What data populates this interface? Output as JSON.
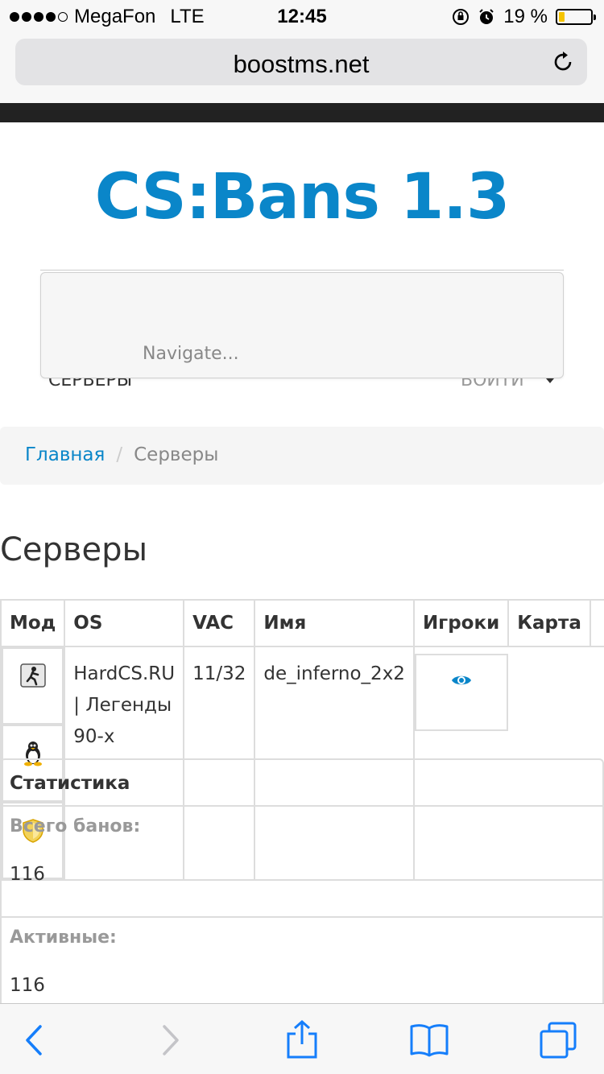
{
  "status_bar": {
    "carrier": "MegaFon",
    "network": "LTE",
    "time": "12:45",
    "battery_percent": "19 %",
    "battery_level": 0.19,
    "battery_color": "#f5c400"
  },
  "browser": {
    "url": "boostms.net"
  },
  "site": {
    "title": "CS:Bans 1.3",
    "title_color": "#0a86c9",
    "nav_placeholder": "Navigate...",
    "nav_servers": "Серверы",
    "nav_login": "Войти"
  },
  "breadcrumb": {
    "home": "Главная",
    "separator": "/",
    "current": "Серверы"
  },
  "page_title": "Серверы",
  "servers_table": {
    "headers": [
      "Мод",
      "OS",
      "VAC",
      "Имя",
      "Игроки",
      "Карта",
      ""
    ],
    "rows": [
      {
        "mod_icon": "cs-mod-icon",
        "os_icon": "linux-tux-icon",
        "vac_icon": "vac-shield-icon",
        "name": "HardCS.RU | Легенды 90-х",
        "players": "11/32",
        "map": "de_inferno_2x2",
        "action_icon": "eye-icon"
      }
    ]
  },
  "stats": {
    "heading": "Статистика",
    "items": [
      {
        "label": "Всего банов:",
        "value": "116"
      },
      {
        "label": "Активные:",
        "value": "116"
      }
    ]
  }
}
